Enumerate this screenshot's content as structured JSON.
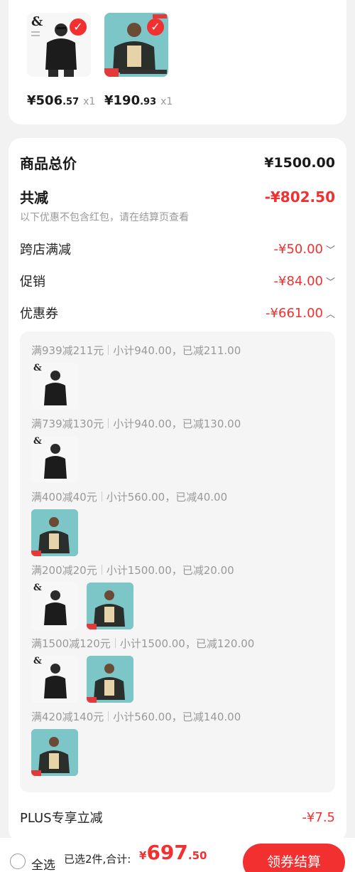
{
  "products": [
    {
      "price_int": "¥506",
      "price_dec": ".57",
      "qty": "x1"
    },
    {
      "price_int": "¥190",
      "price_dec": ".93",
      "qty": "x1"
    }
  ],
  "summary": {
    "total_label": "商品总价",
    "total_value": "¥1500.00",
    "discount_label": "共减",
    "discount_value": "-¥802.50",
    "note": "以下优惠不包含红包，请在结算页查看",
    "cross_label": "跨店满减",
    "cross_value": "-¥50.00",
    "promo_label": "促销",
    "promo_value": "-¥84.00",
    "coupon_label": "优惠券",
    "coupon_value": "-¥661.00",
    "plus_label": "PLUS专享立减",
    "plus_value": "-¥7.5"
  },
  "coupons": [
    {
      "rule": "满939减211元",
      "detail": "小计940.00，已减211.00"
    },
    {
      "rule": "满739减130元",
      "detail": "小计940.00，已减130.00"
    },
    {
      "rule": "满400减40元",
      "detail": "小计560.00，已减40.00"
    },
    {
      "rule": "满200减20元",
      "detail": "小计1500.00，已减20.00"
    },
    {
      "rule": "满1500减120元",
      "detail": "小计1500.00，已减120.00"
    },
    {
      "rule": "满420减140元",
      "detail": "小计560.00，已减140.00"
    }
  ],
  "bottom": {
    "select_all": "全选",
    "selected_info": "已选2件,合计:",
    "currency": "¥",
    "total_int": "697",
    "total_dec": ".50",
    "checkout": "领券结算"
  },
  "icons": {
    "check": "check-icon",
    "chevron_down": "chevron-down-icon",
    "chevron_up": "chevron-up-icon"
  },
  "colors": {
    "accent": "#f23030",
    "background": "#f2f2f2"
  }
}
